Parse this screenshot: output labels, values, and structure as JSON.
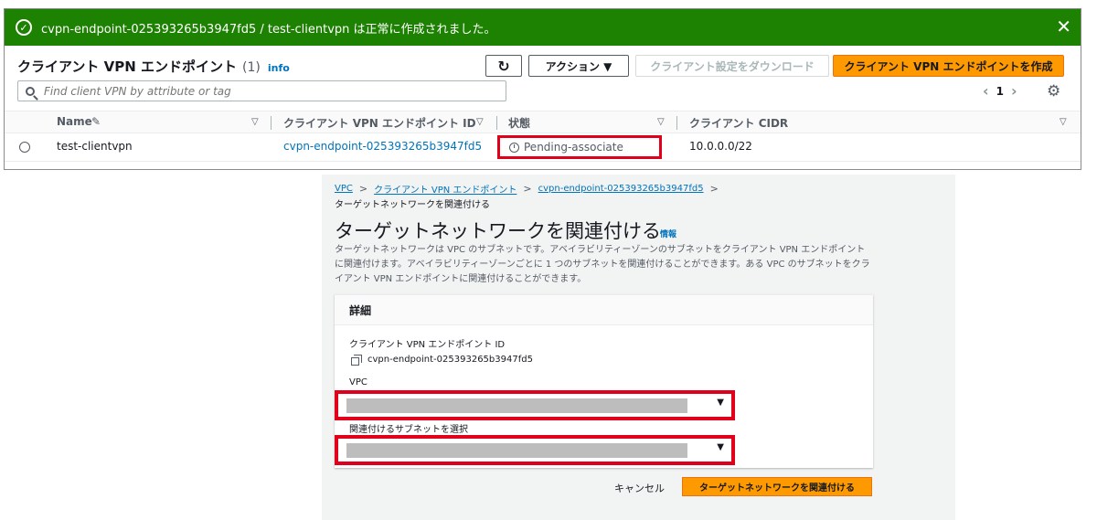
{
  "banner": {
    "message": "cvpn-endpoint-025393265b3947fd5 / test-clientvpn は正常に作成されました。",
    "close": "✕",
    "color": "#1d8102"
  },
  "list": {
    "title": "クライアント VPN エンドポイント",
    "count": "(1)",
    "info": "info",
    "refresh_icon": "refresh-icon",
    "actions_label": "アクション ▼",
    "download_label": "クライアント設定をダウンロード",
    "create_label": "クライアント VPN エンドポイントを作成",
    "search_placeholder": "Find client VPN by attribute or tag",
    "page_number": "1",
    "columns": [
      "Name",
      "クライアント VPN エンドポイント ID",
      "状態",
      "クライアント CIDR"
    ],
    "rows": [
      {
        "name": "test-clientvpn",
        "endpoint_id": "cvpn-endpoint-025393265b3947fd5",
        "status": "Pending-associate",
        "cidr": "10.0.0.0/22"
      }
    ]
  },
  "associate": {
    "breadcrumbs": [
      "VPC",
      "クライアント VPN エンドポイント",
      "cvpn-endpoint-025393265b3947fd5"
    ],
    "breadcrumb_current": "ターゲットネットワークを関連付ける",
    "title": "ターゲットネットワークを関連付ける",
    "info": "情報",
    "description": "ターゲットネットワークは VPC のサブネットです。アベイラビリティーゾーンのサブネットをクライアント VPN エンドポイントに関連付けます。アベイラビリティーゾーンごとに 1 つのサブネットを関連付けることができます。ある VPC のサブネットをクライアント VPN エンドポイントに関連付けることができます。",
    "details_heading": "詳細",
    "endpoint_label": "クライアント VPN エンドポイント ID",
    "endpoint_value": "cvpn-endpoint-025393265b3947fd5",
    "vpc_label": "VPC",
    "subnet_label": "関連付けるサブネットを選択",
    "cancel_label": "キャンセル",
    "submit_label": "ターゲットネットワークを関連付ける"
  }
}
